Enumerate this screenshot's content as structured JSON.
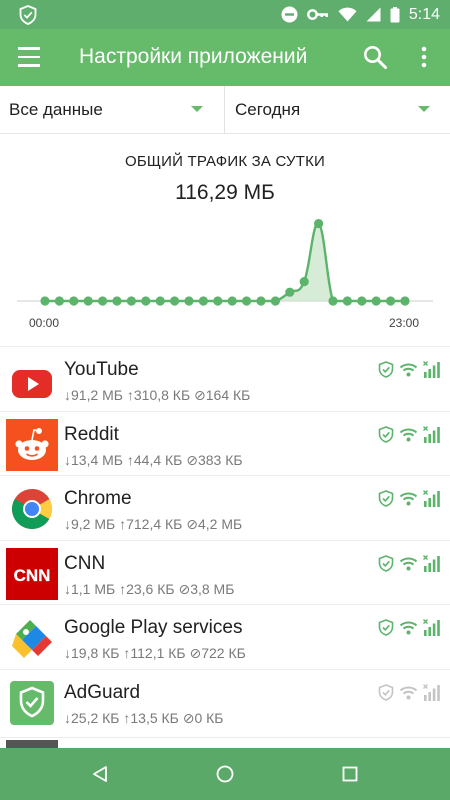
{
  "status_bar": {
    "time": "5:14"
  },
  "app_bar": {
    "title": "Настройки приложений"
  },
  "filters": {
    "data_type": "Все данные",
    "period": "Сегодня"
  },
  "summary": {
    "title": "ОБЩИЙ ТРАФИК ЗА СУТКИ",
    "total": "116,29 МБ"
  },
  "chart_data": {
    "type": "area",
    "x_start_label": "00:00",
    "x_end_label": "23:00",
    "values": [
      0,
      0,
      0,
      0,
      0,
      0,
      0,
      0,
      0,
      0,
      0,
      0,
      0,
      0,
      0,
      0,
      0,
      0.1,
      0.22,
      0.88,
      0,
      0,
      0,
      0,
      0,
      0
    ],
    "point_color": "#5cb36a",
    "fill_color": "#c8e6c9"
  },
  "apps": [
    {
      "name": "YouTube",
      "stats": "↓91,2 МБ ↑310,8 КБ ⊘164 КБ",
      "icon": "youtube-icon",
      "enabled": true
    },
    {
      "name": "Reddit",
      "stats": "↓13,4 МБ ↑44,4 КБ ⊘383 КБ",
      "icon": "reddit-icon",
      "enabled": true
    },
    {
      "name": "Chrome",
      "stats": "↓9,2 МБ ↑712,4 КБ ⊘4,2 МБ",
      "icon": "chrome-icon",
      "enabled": true
    },
    {
      "name": "CNN",
      "stats": "↓1,1 МБ ↑23,6 КБ ⊘3,8 МБ",
      "icon": "cnn-icon",
      "enabled": true
    },
    {
      "name": "Google Play services",
      "stats": "↓19,8 КБ ↑112,1 КБ ⊘722 КБ",
      "icon": "play-services-icon",
      "enabled": true
    },
    {
      "name": "AdGuard",
      "stats": "↓25,2 КБ ↑13,5 КБ ⊘0 КБ",
      "icon": "adguard-icon",
      "enabled": false
    }
  ],
  "colors": {
    "accent": "#66bb6a",
    "status_bar": "#5fae6d",
    "nav_bar": "#5ba968",
    "enabled_icon": "#5cb36a",
    "disabled_icon": "#c4c4c4"
  }
}
